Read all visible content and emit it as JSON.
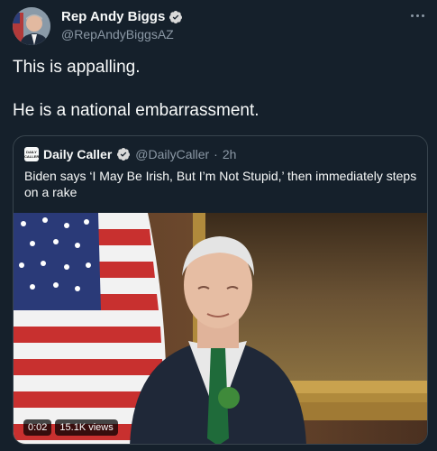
{
  "tweet": {
    "author_name": "Rep Andy Biggs",
    "handle": "@RepAndyBiggsAZ",
    "lines": [
      "This is appalling.",
      "He is a national embarrassment."
    ]
  },
  "quoted": {
    "logo_text": "DAILY CALLER",
    "name": "Daily Caller",
    "handle": "@DailyCaller",
    "separator": "·",
    "time": "2h",
    "text": "Biden says ‘I May Be Irish, But I’m Not Stupid,’ then immediately steps on a rake"
  },
  "video": {
    "duration": "0:02",
    "views": "15.1K views"
  },
  "colors": {
    "background": "#15202b",
    "border": "#38444d",
    "secondary_text": "#8b98a5",
    "verified": "#d9d9d9"
  },
  "icons": [
    "verified-badge-icon",
    "more-options-icon",
    "avatar",
    "daily-caller-logo"
  ]
}
